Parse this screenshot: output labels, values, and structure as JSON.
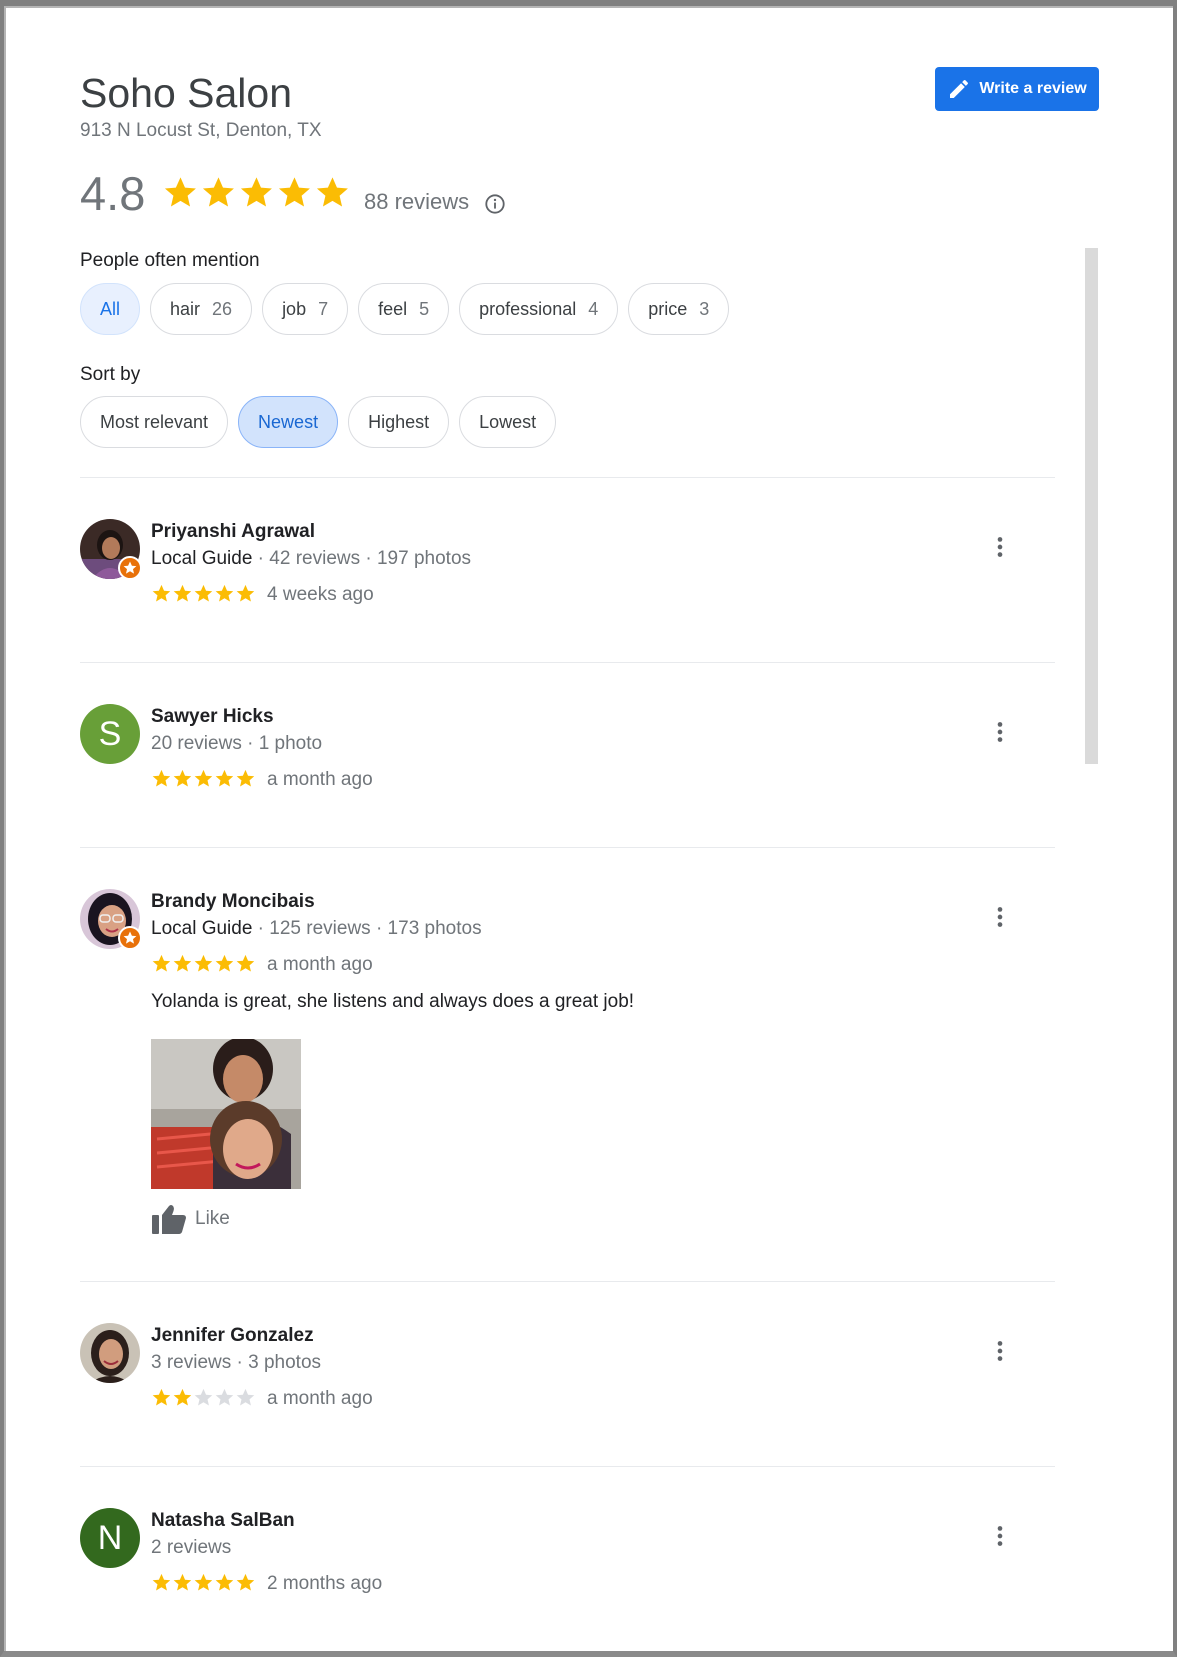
{
  "business": {
    "name": "Soho Salon",
    "address": "913 N Locust St, Denton, TX",
    "rating": "4.8",
    "rating_value": 4.8,
    "review_count": "88 reviews"
  },
  "actions": {
    "write_review": "Write a review"
  },
  "mentions": {
    "label": "People often mention",
    "chips": [
      {
        "label": "All",
        "count": ""
      },
      {
        "label": "hair",
        "count": "26"
      },
      {
        "label": "job",
        "count": "7"
      },
      {
        "label": "feel",
        "count": "5"
      },
      {
        "label": "professional",
        "count": "4"
      },
      {
        "label": "price",
        "count": "3"
      }
    ]
  },
  "sort": {
    "label": "Sort by",
    "options": [
      "Most relevant",
      "Newest",
      "Highest",
      "Lowest"
    ],
    "selected": "Newest"
  },
  "reviews": [
    {
      "name": "Priyanshi Agrawal",
      "guide": "Local Guide",
      "meta": " · 42 reviews · 197 photos",
      "rating": 5,
      "date": "4 weeks ago"
    },
    {
      "name": "Sawyer Hicks",
      "guide": "",
      "meta": "20 reviews · 1 photo",
      "rating": 5,
      "date": "a month ago",
      "avatar_letter": "S",
      "avatar_color": "#689f38"
    },
    {
      "name": "Brandy Moncibais",
      "guide": "Local Guide",
      "meta": " · 125 reviews · 173 photos",
      "rating": 5,
      "date": "a month ago",
      "text": "Yolanda is great, she listens and always does a great job!",
      "like_label": "Like"
    },
    {
      "name": "Jennifer Gonzalez",
      "guide": "",
      "meta": "3 reviews · 3 photos",
      "rating": 2,
      "date": "a month ago"
    },
    {
      "name": "Natasha SalBan",
      "guide": "",
      "meta": "2 reviews",
      "rating": 5,
      "date": "2 months ago",
      "avatar_letter": "N",
      "avatar_color": "#33691e"
    }
  ],
  "colors": {
    "star_filled": "#fbbc04",
    "star_empty": "#dadce0",
    "accent": "#1a73e8",
    "guide_badge": "#e8710a"
  },
  "icons": [
    "pencil-icon",
    "info-icon",
    "more-vert-icon",
    "thumb-up-icon",
    "local-guide-badge-icon",
    "star-icon"
  ]
}
